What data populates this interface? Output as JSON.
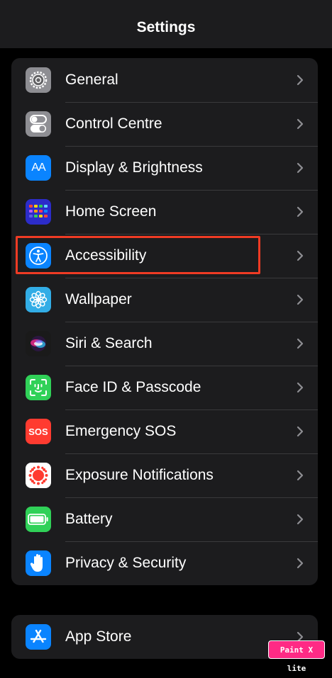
{
  "header": {
    "title": "Settings"
  },
  "groups": [
    {
      "items": [
        {
          "label": "General",
          "icon": "gear-icon",
          "color": "#8e8e93"
        },
        {
          "label": "Control Centre",
          "icon": "toggles-icon",
          "color": "#8e8e93"
        },
        {
          "label": "Display & Brightness",
          "icon": "text-size-icon",
          "color": "#0a84ff",
          "icon_text": "AA"
        },
        {
          "label": "Home Screen",
          "icon": "app-grid-icon",
          "color": "#2c2cc9"
        },
        {
          "label": "Accessibility",
          "icon": "accessibility-icon",
          "color": "#0a84ff",
          "highlighted": true
        },
        {
          "label": "Wallpaper",
          "icon": "flower-icon",
          "color": "#32ade6"
        },
        {
          "label": "Siri & Search",
          "icon": "siri-icon",
          "color": "#1a1a1a"
        },
        {
          "label": "Face ID & Passcode",
          "icon": "face-id-icon",
          "color": "#30d158"
        },
        {
          "label": "Emergency SOS",
          "icon": "sos-icon",
          "color": "#ff3b30",
          "icon_text": "SOS"
        },
        {
          "label": "Exposure Notifications",
          "icon": "exposure-icon",
          "color": "#ffffff"
        },
        {
          "label": "Battery",
          "icon": "battery-icon",
          "color": "#30d158"
        },
        {
          "label": "Privacy & Security",
          "icon": "hand-icon",
          "color": "#0a84ff"
        }
      ]
    },
    {
      "items": [
        {
          "label": "App Store",
          "icon": "app-store-icon",
          "color": "#0a84ff"
        }
      ]
    }
  ],
  "annotation": {
    "highlight_color": "#ef3b24"
  },
  "watermark": {
    "text": "Paint X lite"
  }
}
